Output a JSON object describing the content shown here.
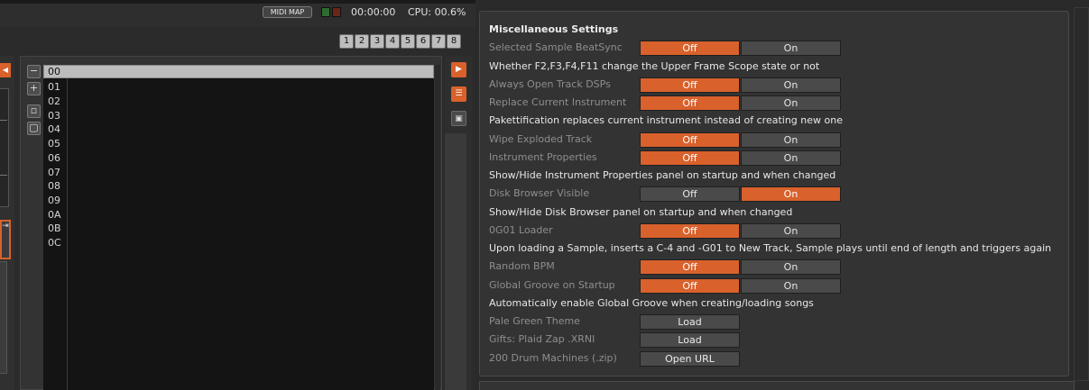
{
  "topbar": {
    "midi_map_label": "MIDI MAP",
    "clock": "00:00:00",
    "cpu": "CPU: 00.6%",
    "track_numbers": [
      "1",
      "2",
      "3",
      "4",
      "5",
      "6",
      "7",
      "8"
    ]
  },
  "sequencer": {
    "controls": {
      "remove": "−",
      "add": "+",
      "btn3": "▫",
      "btn4": "▢"
    },
    "rows": [
      "00",
      "01",
      "02",
      "03",
      "04",
      "05",
      "06",
      "07",
      "08",
      "09",
      "0A",
      "0B",
      "0C"
    ],
    "selected_row": "00"
  },
  "settings": {
    "title": "Miscellaneous Settings",
    "off": "Off",
    "on": "On",
    "load": "Load",
    "open_url": "Open URL",
    "items": {
      "selected_sample_beatsync": "Selected Sample BeatSync",
      "desc_frame_scope": "Whether F2,F3,F4,F11 change the Upper Frame Scope state or not",
      "always_open_track_dsps": "Always Open Track DSPs",
      "replace_current_instrument": "Replace Current Instrument",
      "desc_pakettification": "Pakettification replaces current instrument instead of creating new one",
      "wipe_exploded_track": "Wipe Exploded Track",
      "instrument_properties": "Instrument Properties",
      "desc_instrument_properties": "Show/Hide Instrument Properties panel on startup and when changed",
      "disk_browser_visible": "Disk Browser Visible",
      "desc_disk_browser": "Show/Hide Disk Browser panel on startup and when changed",
      "g01_loader": "0G01 Loader",
      "desc_g01_loader": "Upon loading a Sample, inserts a C-4 and -G01 to New Track, Sample plays until end of length and triggers again",
      "random_bpm": "Random BPM",
      "global_groove_on_startup": "Global Groove on Startup",
      "desc_global_groove": "Automatically enable Global Groove when creating/loading songs",
      "pale_green_theme": "Pale Green Theme",
      "gifts_plaid_zap": "Gifts: Plaid Zap .XRNI",
      "drum_machines": "200 Drum Machines (.zip)"
    }
  },
  "colors": {
    "accent": "#d9612c",
    "panel": "#333333",
    "background": "#2a2a2a"
  }
}
